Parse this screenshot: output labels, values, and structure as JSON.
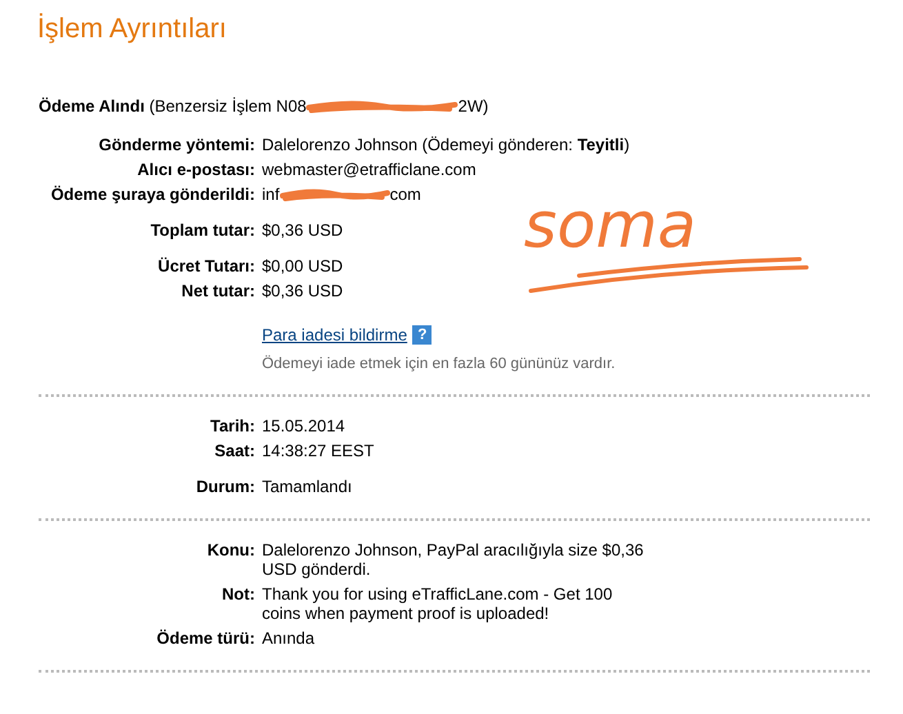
{
  "title": "İşlem Ayrıntıları",
  "header": {
    "label": "Ödeme Alındı",
    "text_before": "(Benzersiz İşlem N08",
    "text_after": "2W)"
  },
  "annotation": "soma",
  "sections": [
    {
      "groups": [
        [
          {
            "kind": "text",
            "label": "Gönderme yöntemi:",
            "value": "Dalelorenzo Johnson (Ödemeyi gönderen: **Teyitli**)"
          },
          {
            "kind": "text",
            "label": "Alıcı e-postası:",
            "value": "webmaster@etrafficlane.com"
          },
          {
            "kind": "redacted",
            "label": "Ödeme şuraya gönderildi:",
            "value_before": "inf",
            "value_after": "com"
          }
        ],
        [
          {
            "kind": "text",
            "label": "Toplam tutar:",
            "value": "$0,36 USD"
          }
        ],
        [
          {
            "kind": "text",
            "label": "Ücret Tutarı:",
            "value": "$0,00 USD"
          },
          {
            "kind": "text",
            "label": "Net tutar:",
            "value": "$0,36 USD"
          }
        ],
        [
          {
            "kind": "link",
            "value": "Para iadesi bildirme",
            "icon": "?"
          },
          {
            "kind": "hint",
            "value": "Ödemeyi iade etmek için en fazla 60 gününüz vardır."
          }
        ]
      ]
    },
    {
      "groups": [
        [
          {
            "kind": "text",
            "label": "Tarih:",
            "value": "15.05.2014"
          },
          {
            "kind": "text",
            "label": "Saat:",
            "value": "14:38:27 EEST"
          }
        ],
        [
          {
            "kind": "text",
            "label": "Durum:",
            "value": "Tamamlandı"
          }
        ]
      ]
    },
    {
      "groups": [
        [
          {
            "kind": "text",
            "label": "Konu:",
            "value": "Dalelorenzo Johnson, PayPal aracılığıyla size $0,36 USD gönderdi."
          },
          {
            "kind": "text",
            "label": "Not:",
            "value": "Thank you for using eTrafficLane.com - Get 100 coins when payment proof is uploaded!"
          },
          {
            "kind": "text",
            "label": "Ödeme türü:",
            "value": "Anında"
          }
        ]
      ]
    }
  ]
}
